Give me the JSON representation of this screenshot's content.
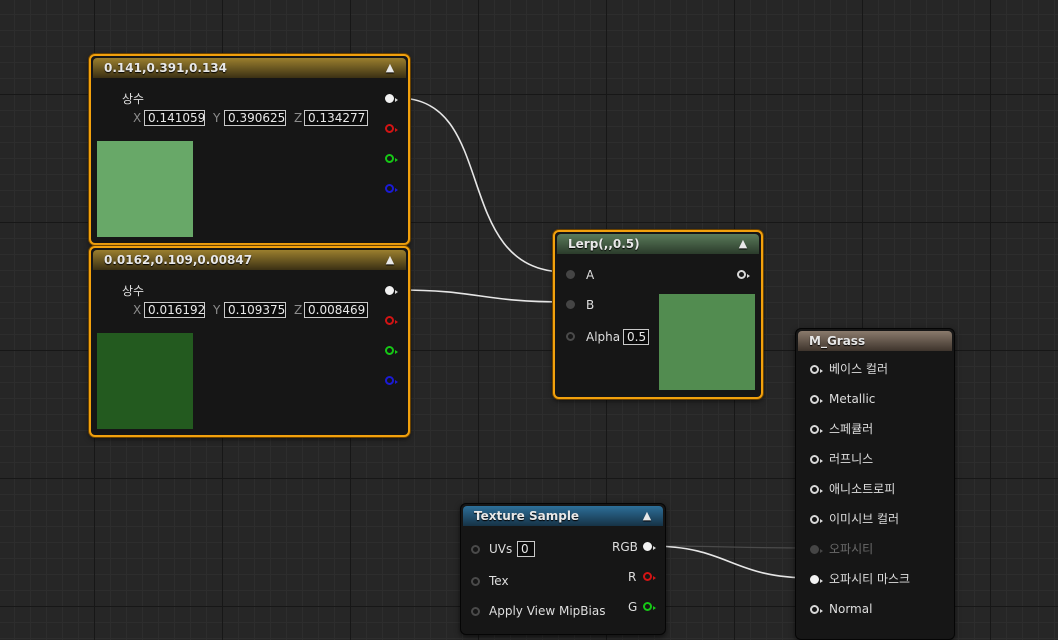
{
  "nodes": {
    "constant1": {
      "title": "0.141,0.391,0.134",
      "label": "상수",
      "x_axis": "X",
      "y_axis": "Y",
      "z_axis": "Z",
      "x": "0.141059",
      "y": "0.390625",
      "z": "0.134277",
      "preview_color": "#68a868"
    },
    "constant2": {
      "title": "0.0162,0.109,0.00847",
      "label": "상수",
      "x_axis": "X",
      "y_axis": "Y",
      "z_axis": "Z",
      "x": "0.016192",
      "y": "0.109375",
      "z": "0.008469",
      "preview_color": "#235a1f"
    },
    "lerp": {
      "title": "Lerp(,,0.5)",
      "input_a": "A",
      "input_b": "B",
      "input_alpha": "Alpha",
      "alpha_value": "0.5",
      "preview_color": "#528c50"
    },
    "texture_sample": {
      "title": "Texture Sample",
      "input_uvs": "UVs",
      "uvs_value": "0",
      "input_tex": "Tex",
      "input_mipbias": "Apply View MipBias",
      "output_rgb": "RGB",
      "output_r": "R",
      "output_g": "G"
    },
    "material": {
      "title": "M_Grass",
      "inputs": [
        "베이스 컬러",
        "Metallic",
        "스페큘러",
        "러프니스",
        "애니소트로피",
        "이미시브 컬러",
        "오파시티",
        "오파시티 마스크",
        "Normal"
      ]
    }
  },
  "colors": {
    "selection": "#f2a10d",
    "pin_red": "#d31414",
    "pin_green": "#16c816",
    "pin_blue": "#1b1bd6",
    "wire": "#e6e6e6"
  },
  "icons": {
    "collapse": "chevron-up-icon"
  }
}
